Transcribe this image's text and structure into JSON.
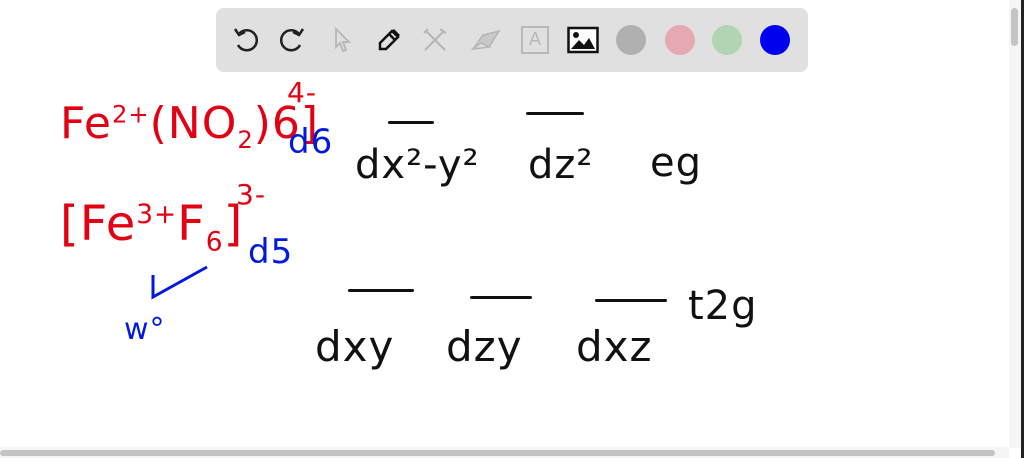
{
  "toolbar": {
    "tools": [
      {
        "name": "undo-icon",
        "state": "enabled"
      },
      {
        "name": "redo-icon",
        "state": "enabled"
      },
      {
        "name": "select-icon",
        "state": "disabled"
      },
      {
        "name": "pen-icon",
        "state": "active"
      },
      {
        "name": "tools-icon",
        "state": "disabled"
      },
      {
        "name": "eraser-icon",
        "state": "disabled"
      },
      {
        "name": "text-icon",
        "state": "disabled",
        "label": "A"
      },
      {
        "name": "image-icon",
        "state": "enabled"
      }
    ],
    "colors": [
      "#b0b0b0",
      "#e6a9b2",
      "#b3d4b3",
      "#0000ee"
    ],
    "selected_color": "#0000ee"
  },
  "canvas": {
    "notes": {
      "complex1": {
        "main": "Fe",
        "ox": "2+",
        "mid": "(NO",
        "sub": "2",
        "rest": ")6]",
        "charge": "4-"
      },
      "d6": "d6",
      "complex2": {
        "open": "[Fe",
        "ox": "3+",
        "mid": "F",
        "six": "6",
        "close": "]",
        "charge": "3-"
      },
      "d5": "d5",
      "w": "w°",
      "dx2y2": "dx²-y²",
      "dz2": "dz²",
      "eg": "eg",
      "dxy": "dxy",
      "dzy": "dzy",
      "dxz": "dxz",
      "t2g": "t2g"
    },
    "colors": {
      "red": "#e30012",
      "blue": "#0018e0",
      "black": "#111111"
    }
  }
}
